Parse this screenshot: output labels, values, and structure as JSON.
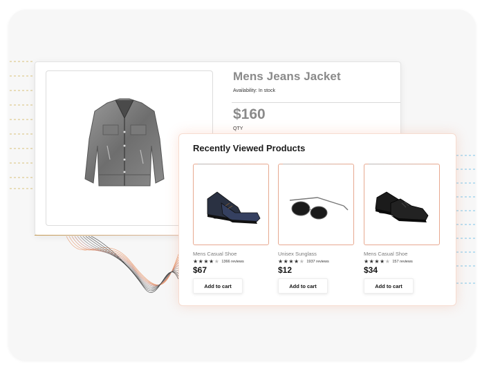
{
  "product": {
    "title": "Mens Jeans Jacket",
    "availability": "Availability: In stock",
    "price": "$160",
    "qty_label": "QTY",
    "image_icon": "jacket-image"
  },
  "recently_viewed": {
    "heading": "Recently Viewed Products",
    "items": [
      {
        "name": "Mens Casual Shoe",
        "rating": 4,
        "reviews": "1366 reviews",
        "price": "$67",
        "button": "Add to cart",
        "image_icon": "dress-shoe-image"
      },
      {
        "name": "Unisex Sunglass",
        "rating": 4,
        "reviews": "1937 reviews",
        "price": "$12",
        "button": "Add to cart",
        "image_icon": "sunglasses-image"
      },
      {
        "name": "Mens Casual Shoe",
        "rating": 4,
        "reviews": "157 reviews",
        "price": "$34",
        "button": "Add to cart",
        "image_icon": "sneaker-image"
      }
    ]
  },
  "colors": {
    "accent_border": "#e7a88f",
    "glow": "#f0825a",
    "dashed_left": "#d8c27a",
    "dashed_right": "#7cc4e8"
  }
}
